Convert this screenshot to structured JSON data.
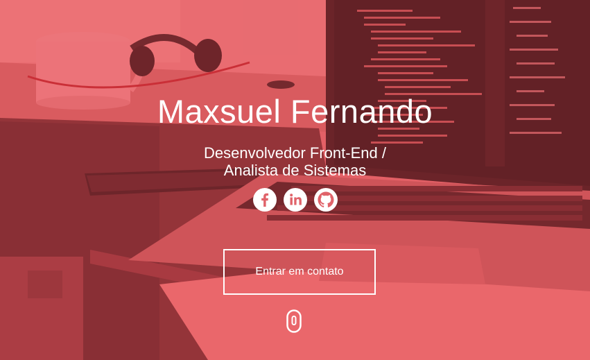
{
  "hero": {
    "name": "Maxsuel Fernando",
    "role_line1": "Desenvolvedor Front-End /",
    "role_line2": "Analista de Sistemas",
    "cta_label": "Entrar em contato"
  },
  "social": [
    {
      "icon": "facebook-icon"
    },
    {
      "icon": "linkedin-icon"
    },
    {
      "icon": "github-icon"
    }
  ],
  "scroll_icon": "mouse-scroll-icon",
  "colors": {
    "overlay": "#f0505a",
    "text": "#ffffff"
  }
}
